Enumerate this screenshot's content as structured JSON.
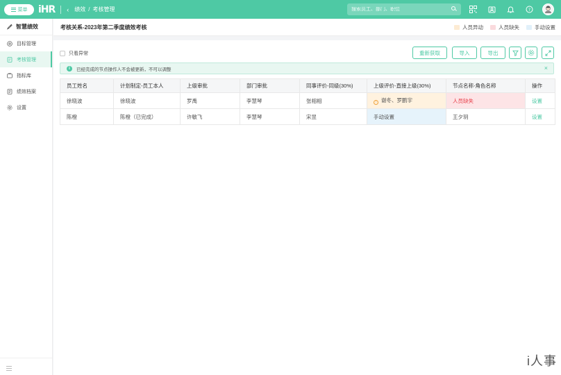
{
  "topbar": {
    "menu_label": "菜单",
    "logo_text": "iHR",
    "breadcrumb": [
      "绩效",
      "考核管理"
    ],
    "breadcrumb_sep": "/",
    "search_placeholder": "搜索员工、部门、职位",
    "icons": [
      "qrcode-icon",
      "contacts-icon",
      "bell-icon",
      "help-icon"
    ],
    "accent_color": "#4ec9a4"
  },
  "sidebar": {
    "header": "智慧绩效",
    "items": [
      {
        "label": "目标管理",
        "icon": "target-icon",
        "active": false
      },
      {
        "label": "考核管理",
        "icon": "review-icon",
        "active": true
      },
      {
        "label": "指标库",
        "icon": "library-icon",
        "active": false
      },
      {
        "label": "绩效档案",
        "icon": "archive-icon",
        "active": false
      },
      {
        "label": "设置",
        "icon": "gear-icon",
        "active": false
      }
    ]
  },
  "page": {
    "title": "考核关系-2023年第二季度绩效考核",
    "legend": [
      {
        "label": "人员异动",
        "color": "#fdebd3"
      },
      {
        "label": "人员缺失",
        "color": "#fadadd"
      },
      {
        "label": "手动设置",
        "color": "#e1f0fa"
      }
    ]
  },
  "toolbar": {
    "only_abnormal_label": "只看异常",
    "refresh_label": "重新获取",
    "import_label": "导入",
    "export_label": "导出"
  },
  "notice": {
    "text": "已经完成的节点操作人不会被更新，不可以调整"
  },
  "table": {
    "headers": [
      "员工姓名",
      "计划制定-员工本人",
      "上级审批",
      "部门审批",
      "同事评价-同级(30%)",
      "上级评价-直接上级(30%)",
      "节点名称-角色名称",
      "操作"
    ],
    "rows": [
      [
        "徐晓波",
        "徐晓波",
        "罗禹",
        "李慧琴",
        "张相相",
        "谢冬、罗鹏宇",
        "人员缺失",
        "设置"
      ],
      [
        "陈橙",
        "陈橙（已完成）",
        "许敏飞",
        "李慧琴",
        "宋昱",
        "手动设置",
        "王夕玥",
        "设置"
      ]
    ]
  },
  "watermark": "i人事"
}
